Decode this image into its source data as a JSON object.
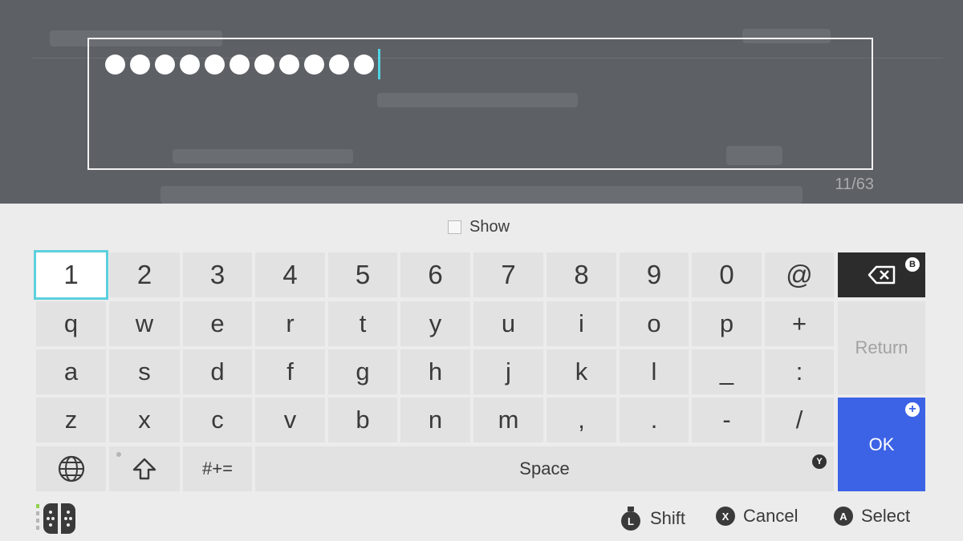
{
  "input": {
    "masked_chars": 11,
    "char_count": "11/63"
  },
  "show_toggle": {
    "label": "Show",
    "checked": false
  },
  "keyboard": {
    "rows": [
      [
        "1",
        "2",
        "3",
        "4",
        "5",
        "6",
        "7",
        "8",
        "9",
        "0",
        "@"
      ],
      [
        "q",
        "w",
        "e",
        "r",
        "t",
        "y",
        "u",
        "i",
        "o",
        "p",
        "+"
      ],
      [
        "a",
        "s",
        "d",
        "f",
        "g",
        "h",
        "j",
        "k",
        "l",
        "_",
        ":"
      ],
      [
        "z",
        "x",
        "c",
        "v",
        "b",
        "n",
        "m",
        ",",
        ".",
        "-",
        "/"
      ]
    ],
    "focused_key": "1",
    "backspace_icon": "backspace-icon",
    "backspace_badge": "B",
    "return_label": "Return",
    "ok_label": "OK",
    "ok_badge": "+",
    "globe_icon": "globe-icon",
    "shift_icon": "shift-arrow-icon",
    "symbols_label": "#+=",
    "space_label": "Space",
    "space_badge": "Y"
  },
  "footer": {
    "controller_icon": "joycon-icon",
    "shift_hint": {
      "button": "L",
      "label": "Shift"
    },
    "cancel_hint": {
      "button": "X",
      "label": "Cancel"
    },
    "select_hint": {
      "button": "A",
      "label": "Select"
    }
  },
  "colors": {
    "accent_focus": "#5cd0dd",
    "ok_blue": "#3c63e6",
    "backspace_dark": "#2c2c2c",
    "caret": "#4fd4e6"
  }
}
